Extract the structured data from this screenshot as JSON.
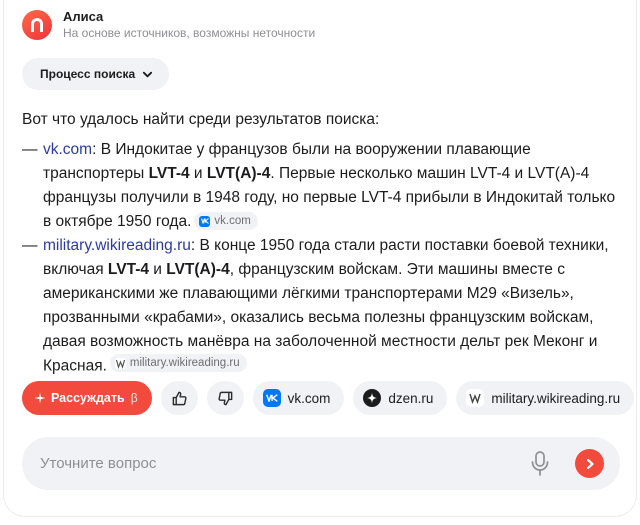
{
  "header": {
    "name": "Алиса",
    "subtitle": "На основе источников, возможны неточности"
  },
  "process": {
    "label": "Процесс поиска",
    "icon": "chevron-down-icon"
  },
  "answer": {
    "intro": "Вот что удалось найти среди результатов поиска:",
    "items": [
      {
        "dash": "—",
        "source_link": "vk.com",
        "t1": ": В Индокитае у французов были на вооружении плавающие транспортеры ",
        "b1": "LVT-4",
        "t2": " и ",
        "b2": "LVT(A)-4",
        "t3": ". Первые несколько машин LVT-4 и LVT(A)-4 французы получили в 1948 году, но первые LVT-4 прибыли в Индокитай только в октябре 1950 года.",
        "chip": "vk.com"
      },
      {
        "dash": "—",
        "source_link": "military.wikireading.ru",
        "t1": ": В конце 1950 года стали расти поставки боевой техники, включая ",
        "b1": "LVT-4",
        "t2": " и ",
        "b2": "LVT(A)-4",
        "t3": ", французским войскам. Эти машины вместе с американскими же плавающими лёгкими транспортерами M29 «Визель», прозванными «крабами», оказались весьма полезны французским войскам, давая возможность манёвра на заболоченной местности дельт рек Меконг и Красная.",
        "chip": "military.wikireading.ru"
      }
    ]
  },
  "actions": {
    "reason_label": "Рассуждать",
    "reason_beta": "β",
    "sources": [
      "vk.com",
      "dzen.ru",
      "military.wikireading.ru"
    ]
  },
  "input": {
    "placeholder": "Уточните вопрос"
  },
  "colors": {
    "accent": "#f24a3c",
    "link": "#2b3aa8",
    "chip_bg": "#f1f2f5",
    "vk": "#0077ff"
  }
}
